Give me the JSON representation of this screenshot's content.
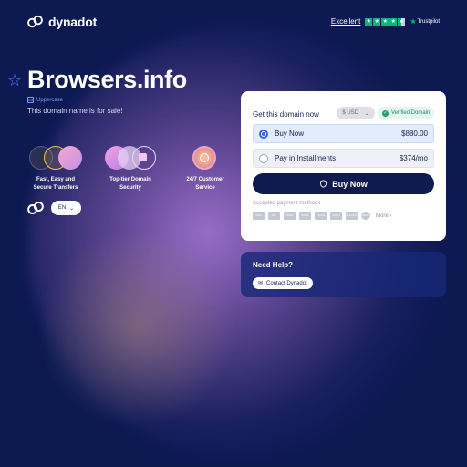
{
  "header": {
    "brand": "dynadot",
    "rating_label": "Excellent",
    "trustpilot": "Trustpilot",
    "rating_stars": 4.5
  },
  "hero": {
    "domain": "Browsers.info",
    "case_label": "Uppercase",
    "sale_text": "This domain name is for sale!"
  },
  "features": [
    {
      "label_line1": "Fast, Easy and",
      "label_line2": "Secure Transfers",
      "icon": "transfer-icon"
    },
    {
      "label_line1": "Top-tier Domain",
      "label_line2": "Security",
      "icon": "lock-icon"
    },
    {
      "label_line1": "24/7 Customer",
      "label_line2": "Service",
      "icon": "clock-icon"
    }
  ],
  "language": {
    "selected": "EN"
  },
  "purchase": {
    "heading": "Get this domain now",
    "currency": "$ USD",
    "verified": "Verified Domain",
    "options": [
      {
        "label": "Buy Now",
        "price": "$880.00",
        "selected": true
      },
      {
        "label": "Pay in Installments",
        "price": "$374/mo",
        "selected": false
      }
    ],
    "buy_button": "Buy Now",
    "payment_label": "Accepted payment methods",
    "payment_icons": [
      "VISA",
      "MC",
      "AMEX",
      "BANK",
      "PayPal",
      "Alipay",
      "UnionPay",
      "Bitcoin"
    ],
    "more": "More"
  },
  "help": {
    "title": "Need Help?",
    "contact_button": "Contact Dynadot"
  },
  "colors": {
    "background": "#0d1a52",
    "accent": "#3564e6",
    "trust_green": "#00b67a",
    "button_dark": "#0f1a4f"
  }
}
